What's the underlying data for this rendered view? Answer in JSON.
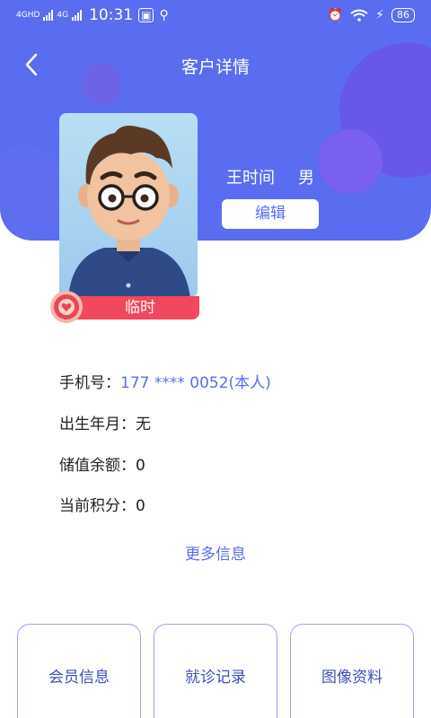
{
  "status_bar": {
    "network1": "4GHD",
    "network2": "4G",
    "time": "10:31",
    "battery": "86"
  },
  "header": {
    "title": "客户详情"
  },
  "profile": {
    "name": "王时间",
    "gender": "男",
    "edit_label": "编辑",
    "member_badge": "临时"
  },
  "info": {
    "phone_label": "手机号：",
    "phone_value": "177 **** 0052(本人)",
    "birth_label": "出生年月：",
    "birth_value": "无",
    "balance_label": "储值余额：",
    "balance_value": "0",
    "points_label": "当前积分：",
    "points_value": "0",
    "more_label": "更多信息"
  },
  "tiles": [
    {
      "label": "会员信息"
    },
    {
      "label": "就诊记录"
    },
    {
      "label": "图像资料"
    }
  ],
  "colors": {
    "accent": "#5a6cf0",
    "badge": "#f2475c"
  }
}
